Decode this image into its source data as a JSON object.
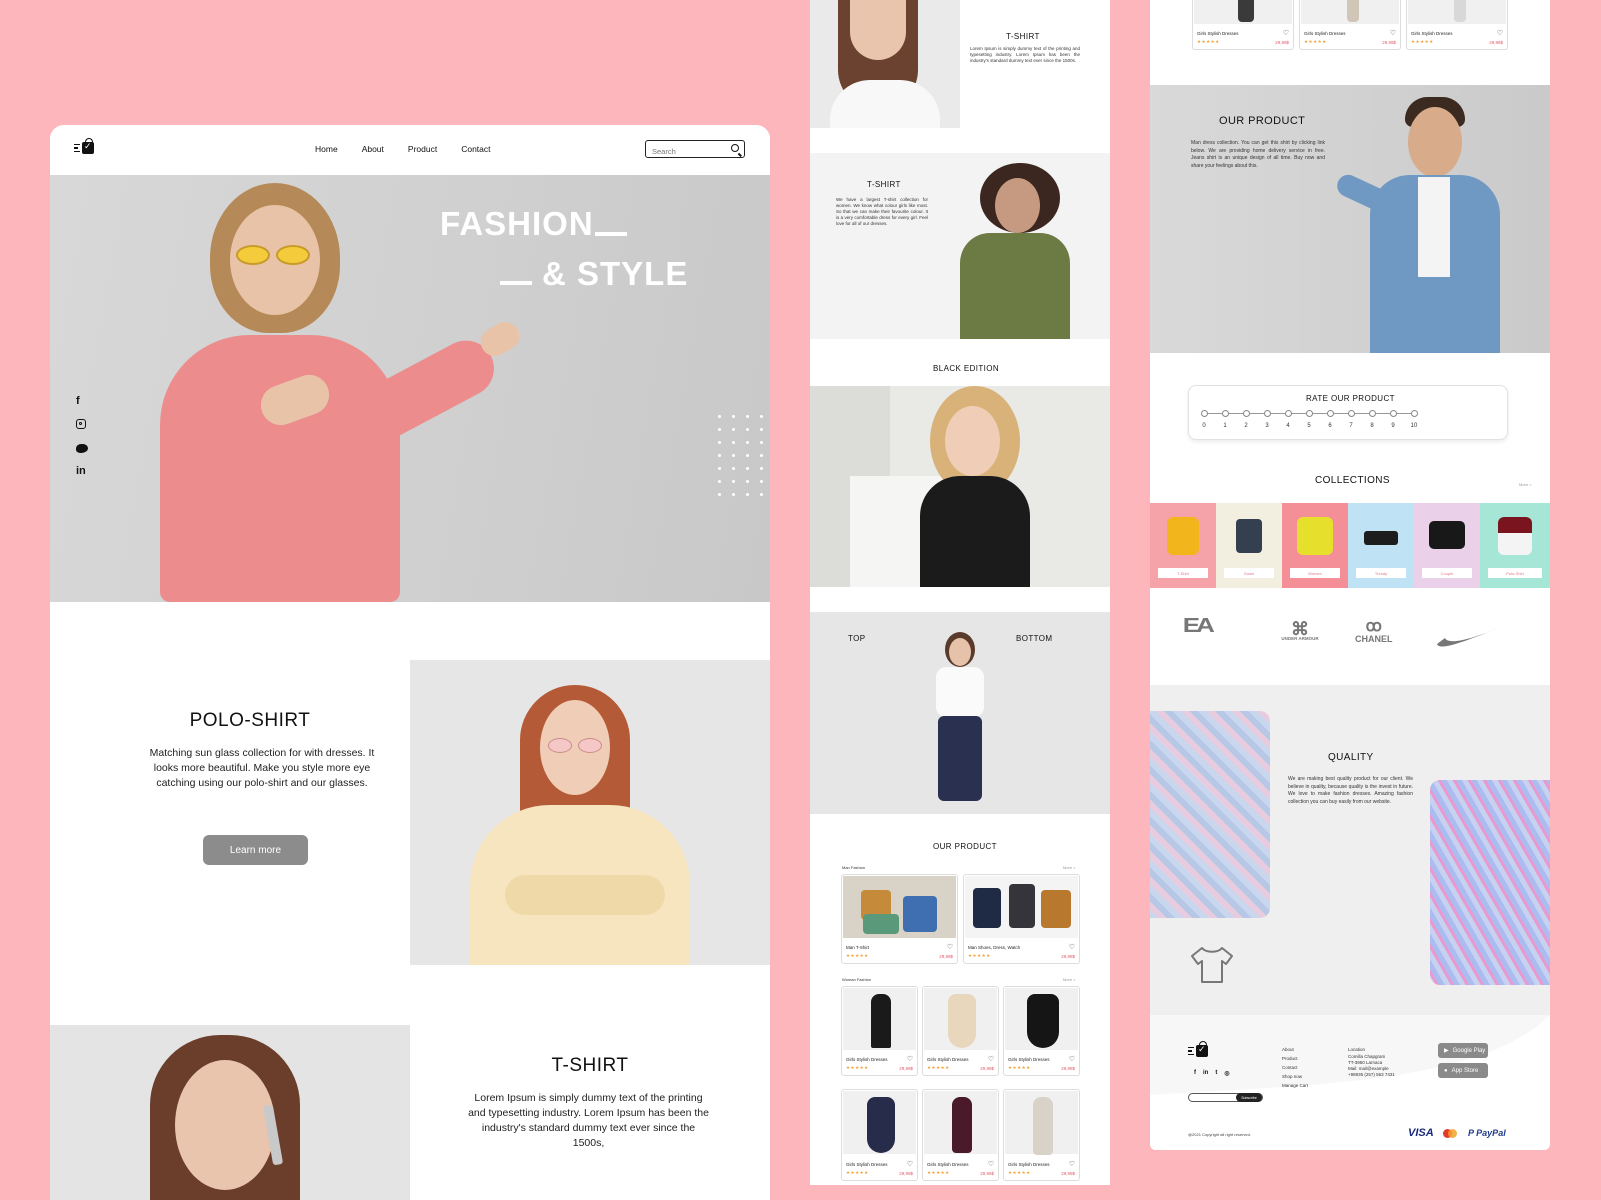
{
  "nav": {
    "links": [
      "Home",
      "About",
      "Product",
      "Contact"
    ],
    "search_placeholder": "Search"
  },
  "hero": {
    "title_line1": "FASHION",
    "title_line2": "& STYLE",
    "social_icons": [
      "facebook-icon",
      "instagram-icon",
      "twitter-icon",
      "linkedin-icon"
    ]
  },
  "polo": {
    "title": "POLO-SHIRT",
    "text": "Matching sun glass collection for with dresses. It looks more beautiful. Make you style more eye catching using our polo-shirt and our glasses.",
    "button": "Learn more"
  },
  "tshirt": {
    "title": "T-SHIRT",
    "text": "Lorem Ipsum is simply dummy text of the printing and typesetting industry. Lorem Ipsum has been the industry's standard dummy text ever since the 1500s,"
  },
  "panel2": {
    "tshirt_title": "T-SHIRT",
    "tshirt_text": "Lorem Ipsum is simply dummy text of the printing and typesetting industry. Lorem Ipsum has been the industry's standard dummy text ever since the 1500s.",
    "tshirt2_title": "T-SHIRT",
    "tshirt2_text": "We have a largest T-shirt collection for women. We know what colour girls like most. So that we can make their favourite colour. It is a very comfortable dress for every girl. Feel love for all of our dresses.",
    "black_edition": "BLACK EDITION",
    "top": "TOP",
    "bottom": "BOTTOM",
    "our_product": "OUR PRODUCT",
    "men_fashion": "Man Fashion",
    "women_fashion": "Woman Fashion",
    "more": "More >",
    "men_cards": [
      {
        "name": "Man T-Shirt",
        "price": "29,99$"
      },
      {
        "name": "Man Shoes, Dress, Watch",
        "price": "29,99$"
      }
    ],
    "women_cards": [
      {
        "name": "Girls Stylish Dresses",
        "price": "29,99$"
      },
      {
        "name": "Girls Stylish Dresses",
        "price": "29,99$"
      },
      {
        "name": "Girls Stylish Dresses",
        "price": "29,99$"
      },
      {
        "name": "Girls Stylish Dresses",
        "price": "29,99$"
      },
      {
        "name": "Girls Stylish Dresses",
        "price": "29,99$"
      },
      {
        "name": "Girls Stylish Dresses",
        "price": "29,99$"
      }
    ],
    "stars": "★★★★★"
  },
  "panel3": {
    "top_cards": [
      {
        "name": "Girls Stylish Dresses",
        "price": "29,99$"
      },
      {
        "name": "Girls Stylish Dresses",
        "price": "29,99$"
      },
      {
        "name": "Girls Stylish Dresses",
        "price": "29,99$"
      }
    ],
    "our_product_title": "OUR PRODUCT",
    "our_product_text": "Man dress collection. You can get this shirt by clicking link below. We are providing home delivery service in free. Jeans shirt is an unique design of all time. Buy now and share your feelings about this.",
    "rate_title": "RATE OUR PRODUCT",
    "rate_values": [
      "0",
      "1",
      "2",
      "3",
      "4",
      "5",
      "6",
      "7",
      "8",
      "9",
      "10"
    ],
    "collections_title": "COLLECTIONS",
    "collections_more": "More >",
    "collections": [
      {
        "label": "T-Shirt",
        "bg": "#f5a3a8"
      },
      {
        "label": "Gown",
        "bg": "#f3efe0"
      },
      {
        "label": "Women",
        "bg": "#f58f97"
      },
      {
        "label": "Trendy",
        "bg": "#bfe3f5"
      },
      {
        "label": "Couple",
        "bg": "#ead0e8"
      },
      {
        "label": "Polo-Shirt",
        "bg": "#a6e6d6"
      }
    ],
    "brands": [
      "EA",
      "UNDER ARMOUR",
      "CHANEL",
      "nike"
    ],
    "quality_title": "QUALITY",
    "quality_text": "We are making best quality product for our client. We believe in quality, because quality is the invest in future. We love to make fashion dresses. Amazing fashion collection you can buy easily from our website.",
    "footer": {
      "links": [
        "About",
        "Product",
        "Contact",
        "Shop now",
        "Manage Cart"
      ],
      "location_title": "Location",
      "location_lines": [
        "Comilla Chapgram",
        "TT-3950 Larnaca",
        "Mail: mail@example",
        "+98935 (257) 563 7431"
      ],
      "google_play": "Google Play",
      "app_store": "App Store",
      "subscribe": "Subscribe",
      "copyright": "@2021 Copyright all right reserved.",
      "payments": [
        "VISA",
        "mastercard",
        "PayPal"
      ]
    }
  },
  "colors": {
    "background": "#fdb7bc",
    "button": "#8c8c8c",
    "price": "#e05c6a",
    "stars": "#f2a33a"
  }
}
